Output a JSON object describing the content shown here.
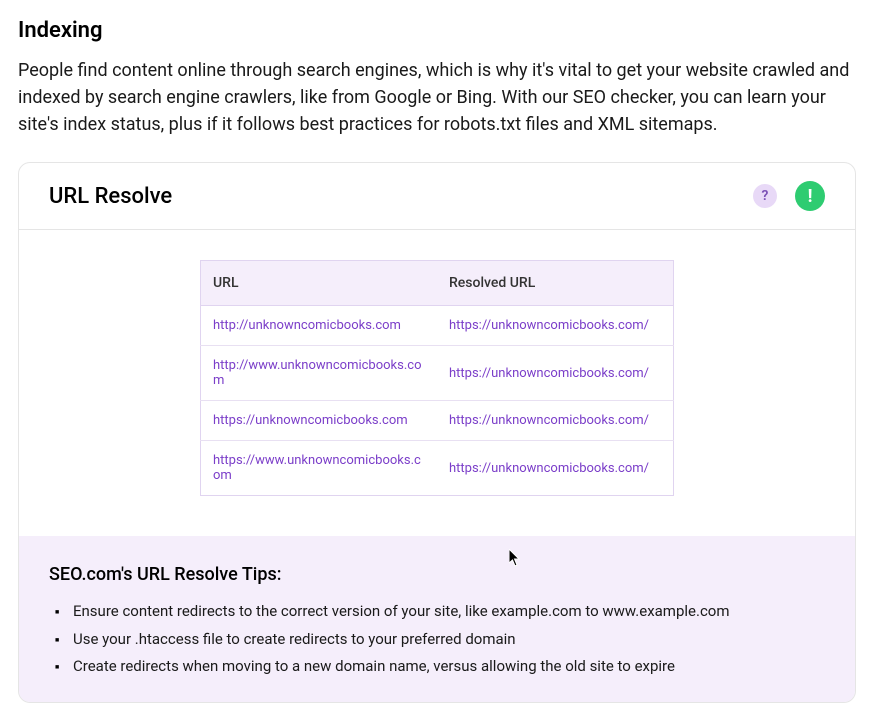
{
  "section": {
    "title": "Indexing",
    "description": "People find content online through search engines, which is why it's vital to get your website crawled and indexed by search engine crawlers, like from Google or Bing. With our SEO checker, you can learn your site's index status, plus if it follows best practices for robots.txt files and XML sitemaps."
  },
  "card": {
    "title": "URL Resolve",
    "help_glyph": "?",
    "status_glyph": "!"
  },
  "table": {
    "headers": {
      "url": "URL",
      "resolved": "Resolved URL"
    },
    "rows": [
      {
        "url": "http://unknowncomicbooks.com",
        "resolved": "https://unknowncomicbooks.com/"
      },
      {
        "url": "http://www.unknowncomicbooks.com",
        "resolved": "https://unknowncomicbooks.com/"
      },
      {
        "url": "https://unknowncomicbooks.com",
        "resolved": "https://unknowncomicbooks.com/"
      },
      {
        "url": "https://www.unknowncomicbooks.com",
        "resolved": "https://unknowncomicbooks.com/"
      }
    ]
  },
  "tips": {
    "title": "SEO.com's URL Resolve Tips:",
    "items": [
      "Ensure content redirects to the correct version of your site, like example.com to www.example.com",
      "Use your .htaccess file to create redirects to your preferred domain",
      "Create redirects when moving to a new domain name, versus allowing the old site to expire"
    ]
  }
}
